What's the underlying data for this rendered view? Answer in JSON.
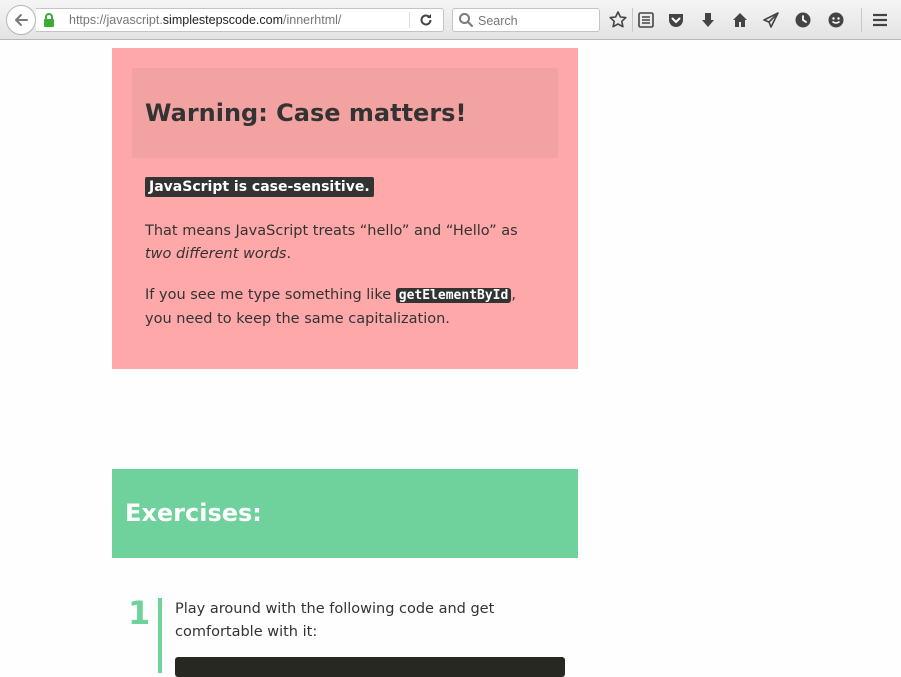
{
  "browser": {
    "url_prefix": "https://javascript.",
    "url_domain": "simplestepscode.com",
    "url_suffix": "/innerhtml/",
    "search_placeholder": "Search"
  },
  "warning": {
    "title": "Warning: Case matters!",
    "badge": "JavaScript is case-sensitive.",
    "p1_text": "That means JavaScript treats “hello” and “Hello” as ",
    "p1_em": "two different words",
    "p1_end": ".",
    "p2_start": "If you see me type something like ",
    "p2_code": "getElementById",
    "p2_end": ", you need to keep the same capitalization."
  },
  "exercises": {
    "title": "Exercises:",
    "items": [
      {
        "number": "1",
        "text": "Play around with the following code and get comfortable with it:"
      }
    ]
  }
}
